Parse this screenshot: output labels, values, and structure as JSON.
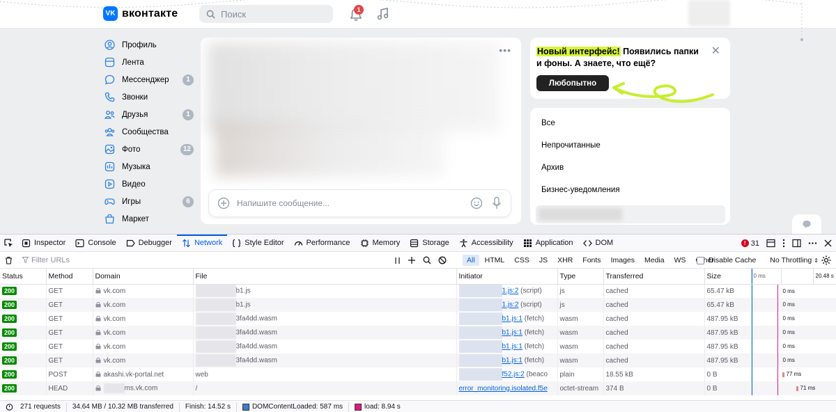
{
  "vk": {
    "logo_text": "вконтакте",
    "search_placeholder": "Поиск",
    "notifications_count": "1",
    "nav": [
      {
        "label": "Профиль",
        "icon": "user-icon",
        "count": ""
      },
      {
        "label": "Лента",
        "icon": "feed-icon",
        "count": ""
      },
      {
        "label": "Мессенджер",
        "icon": "message-icon",
        "count": "1"
      },
      {
        "label": "Звонки",
        "icon": "phone-icon",
        "count": ""
      },
      {
        "label": "Друзья",
        "icon": "friends-icon",
        "count": "1"
      },
      {
        "label": "Сообщества",
        "icon": "communities-icon",
        "count": ""
      },
      {
        "label": "Фото",
        "icon": "photo-icon",
        "count": "12"
      },
      {
        "label": "Музыка",
        "icon": "music-icon",
        "count": ""
      },
      {
        "label": "Видео",
        "icon": "video-icon",
        "count": ""
      },
      {
        "label": "Игры",
        "icon": "gamepad-icon",
        "count": "6"
      },
      {
        "label": "Маркет",
        "icon": "market-icon",
        "count": ""
      }
    ],
    "composer_placeholder": "Напишите сообщение...",
    "promo": {
      "highlight": "Новый интерфейс!",
      "text": " Появились папки и фоны. А знаете, что ещё?",
      "button": "Любопытно",
      "accent": "#d6f33b"
    },
    "folders": [
      "Все",
      "Непрочитанные",
      "Архив",
      "Бизнес-уведомления"
    ]
  },
  "devtools": {
    "tabs": [
      {
        "label": "Inspector",
        "icon": "inspector-icon"
      },
      {
        "label": "Console",
        "icon": "console-icon"
      },
      {
        "label": "Debugger",
        "icon": "debugger-icon"
      },
      {
        "label": "Network",
        "icon": "network-icon",
        "active": true
      },
      {
        "label": "Style Editor",
        "icon": "style-editor-icon"
      },
      {
        "label": "Performance",
        "icon": "performance-icon"
      },
      {
        "label": "Memory",
        "icon": "memory-icon"
      },
      {
        "label": "Storage",
        "icon": "storage-icon"
      },
      {
        "label": "Accessibility",
        "icon": "accessibility-icon"
      },
      {
        "label": "Application",
        "icon": "application-icon"
      },
      {
        "label": "DOM",
        "icon": "dom-icon"
      }
    ],
    "error_count": "31",
    "filter_placeholder": "Filter URLs",
    "types": [
      "All",
      "HTML",
      "CSS",
      "JS",
      "XHR",
      "Fonts",
      "Images",
      "Media",
      "WS",
      "Other"
    ],
    "active_type": "All",
    "disable_cache_label": "Disable Cache",
    "throttling_label": "No Throttling",
    "columns": [
      "Status",
      "Method",
      "Domain",
      "File",
      "Initiator",
      "Type",
      "Transferred",
      "Size"
    ],
    "waterfall_ticks": [
      "0 ms",
      "20.48 s"
    ],
    "rows": [
      {
        "status": "200",
        "method": "GET",
        "domain": "vk.com",
        "file": "b1.js",
        "initiator_link": "1.js:2",
        "initiator_kind": " (script)",
        "type": "js",
        "transferred": "cached",
        "size": "65.47 kB",
        "timing": "0 ms"
      },
      {
        "status": "200",
        "method": "GET",
        "domain": "vk.com",
        "file": "b1.js",
        "initiator_link": "1.js:2",
        "initiator_kind": " (script)",
        "type": "js",
        "transferred": "cached",
        "size": "65.47 kB",
        "timing": "0 ms"
      },
      {
        "status": "200",
        "method": "GET",
        "domain": "vk.com",
        "file": "3fa4dd.wasm",
        "initiator_link": "b1.js:1",
        "initiator_kind": " (fetch)",
        "type": "wasm",
        "transferred": "cached",
        "size": "487.95 kB",
        "timing": "0 ms"
      },
      {
        "status": "200",
        "method": "GET",
        "domain": "vk.com",
        "file": "3fa4dd.wasm",
        "initiator_link": "b1.js:1",
        "initiator_kind": " (fetch)",
        "type": "wasm",
        "transferred": "cached",
        "size": "487.95 kB",
        "timing": "0 ms"
      },
      {
        "status": "200",
        "method": "GET",
        "domain": "vk.com",
        "file": "3fa4dd.wasm",
        "initiator_link": "b1.js:1",
        "initiator_kind": " (fetch)",
        "type": "wasm",
        "transferred": "cached",
        "size": "487.95 kB",
        "timing": "0 ms"
      },
      {
        "status": "200",
        "method": "GET",
        "domain": "vk.com",
        "file": "3fa4dd.wasm",
        "initiator_link": "b1.js:1",
        "initiator_kind": " (fetch)",
        "type": "wasm",
        "transferred": "cached",
        "size": "487.95 kB",
        "timing": "0 ms"
      },
      {
        "status": "200",
        "method": "POST",
        "domain": "akashi.vk-portal.net",
        "file": "web",
        "initiator_link": "f52.js:2",
        "initiator_kind": " (beaco",
        "type": "plain",
        "transferred": "18.55 kB",
        "size": "0 B",
        "timing": "77 ms"
      },
      {
        "status": "200",
        "method": "HEAD",
        "domain": "ms.vk.com",
        "file": "/",
        "initiator_link": "error_monitoring.isolated.f5e",
        "initiator_kind": "",
        "type": "octet-stream",
        "transferred": "374 B",
        "size": "0 B",
        "timing": "71 ms"
      }
    ],
    "status_bar": {
      "requests": "271 requests",
      "transferred": "34.64 MB / 10.32 MB transferred",
      "finish": "Finish: 14.52 s",
      "dcl": "DOMContentLoaded: 587 ms",
      "load": "load: 8.94 s"
    },
    "colors": {
      "accent": "#0060df",
      "status_ok": "#058b00",
      "load_marker": "#e31587"
    }
  }
}
